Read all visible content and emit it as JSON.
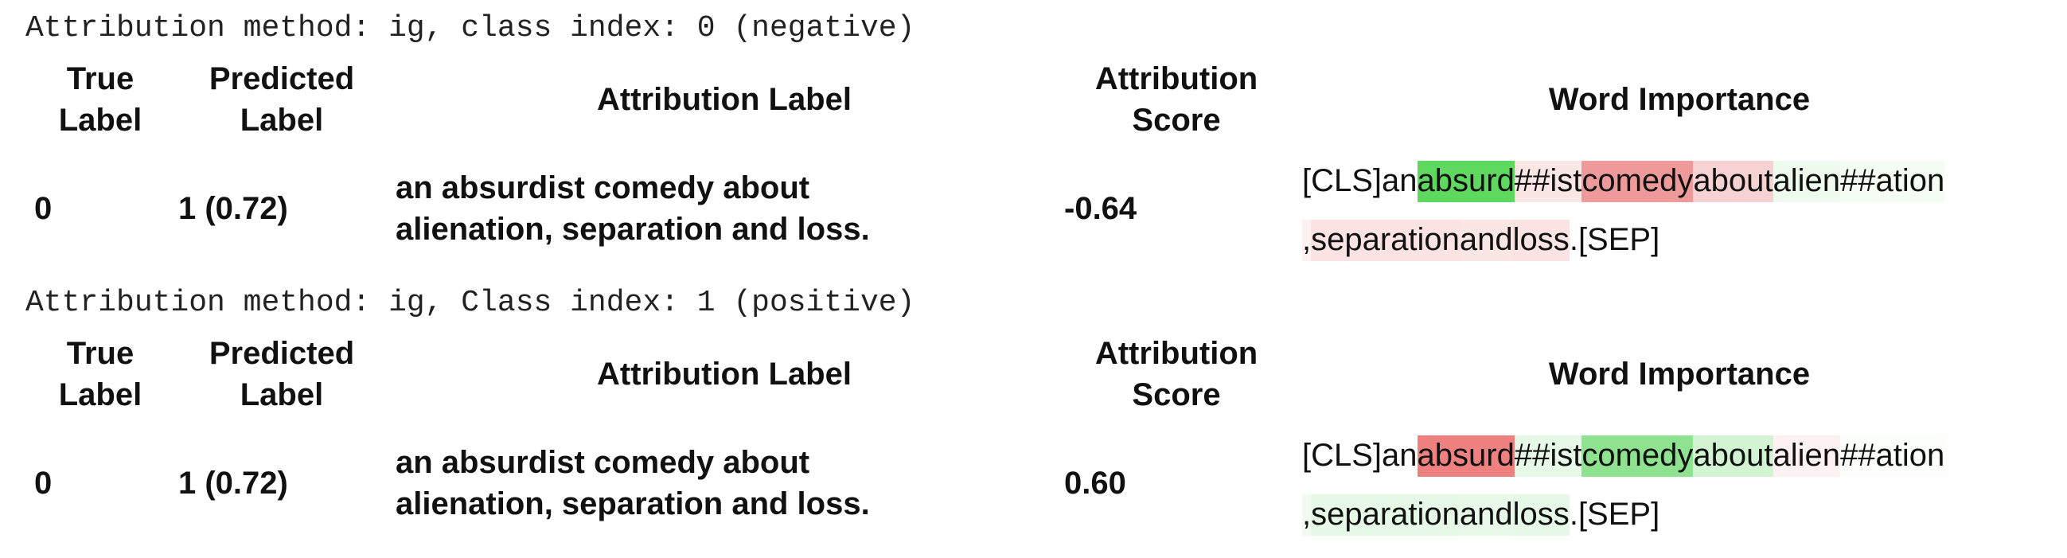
{
  "tables": [
    {
      "method_line": "Attribution method: ig, class index: 0 (negative)",
      "headers": {
        "true_label": [
          "True",
          "Label"
        ],
        "predicted_label": [
          "Predicted",
          "Label"
        ],
        "attribution_label": "Attribution Label",
        "attribution_score": [
          "Attribution",
          "Score"
        ],
        "word_importance": "Word Importance"
      },
      "row": {
        "true_label": "0",
        "predicted_label": "1 (0.72)",
        "attribution_label": [
          "an absurdist comedy about",
          "alienation, separation and loss."
        ],
        "attribution_score": "-0.64"
      },
      "tokens": [
        {
          "text": "[CLS] ",
          "color": "#ffffff"
        },
        {
          "text": "an ",
          "color": "#ffffff"
        },
        {
          "text": "absurd ",
          "color": "#5fd85f"
        },
        {
          "text": "##ist ",
          "color": "#fbe6e6"
        },
        {
          "text": "comedy ",
          "color": "#ef9a9a"
        },
        {
          "text": "about ",
          "color": "#f7d2d2"
        },
        {
          "text": "alien ",
          "color": "#eefaee"
        },
        {
          "text": "##ation",
          "color": "#f4fcf4"
        },
        {
          "text": ", ",
          "color": "#fdf1f1"
        },
        {
          "text": "separation ",
          "color": "#fbe3e3"
        },
        {
          "text": "and ",
          "color": "#fbe6e6"
        },
        {
          "text": "loss ",
          "color": "#fbe3e3"
        },
        {
          "text": ". ",
          "color": "#ffffff"
        },
        {
          "text": "[SEP]",
          "color": "#ffffff"
        }
      ]
    },
    {
      "method_line": "Attribution method: ig, Class index: 1 (positive)",
      "headers": {
        "true_label": [
          "True",
          "Label"
        ],
        "predicted_label": [
          "Predicted",
          "Label"
        ],
        "attribution_label": "Attribution Label",
        "attribution_score": [
          "Attribution",
          "Score"
        ],
        "word_importance": "Word Importance"
      },
      "row": {
        "true_label": "0",
        "predicted_label": "1 (0.72)",
        "attribution_label": [
          "an absurdist comedy about",
          "alienation, separation and loss."
        ],
        "attribution_score": "0.60"
      },
      "tokens": [
        {
          "text": "[CLS] ",
          "color": "#ffffff"
        },
        {
          "text": "an ",
          "color": "#ffffff"
        },
        {
          "text": "absurd ",
          "color": "#ee8080"
        },
        {
          "text": "##ist ",
          "color": "#e6f8e6"
        },
        {
          "text": "comedy ",
          "color": "#8fe28f"
        },
        {
          "text": "about ",
          "color": "#d2f4d2"
        },
        {
          "text": "alien ",
          "color": "#fdf1f1"
        },
        {
          "text": "##ation",
          "color": "#fbfefb"
        },
        {
          "text": ", ",
          "color": "#f2fbf2"
        },
        {
          "text": "separation ",
          "color": "#e6f8e6"
        },
        {
          "text": "and ",
          "color": "#e9f9e9"
        },
        {
          "text": "loss ",
          "color": "#e6f8e6"
        },
        {
          "text": ". ",
          "color": "#ffffff"
        },
        {
          "text": "[SEP]",
          "color": "#ffffff"
        }
      ]
    }
  ]
}
